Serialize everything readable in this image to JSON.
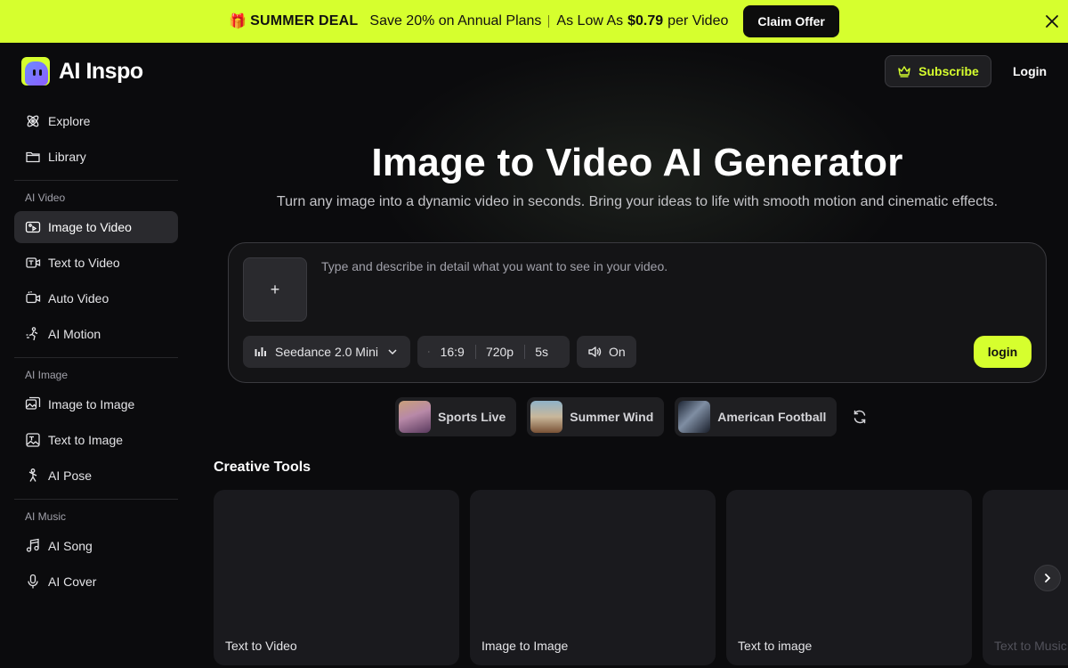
{
  "promo": {
    "gift_icon": "🎁",
    "deal_label": "SUMMER DEAL",
    "offer_text": "Save 20% on Annual Plans",
    "price_prefix": "As Low As",
    "price": "$0.79",
    "price_suffix": "per Video",
    "cta_label": "Claim Offer"
  },
  "brand": {
    "name": "AI Inspo",
    "accent_color": "#d6ff2e"
  },
  "header": {
    "subscribe_label": "Subscribe",
    "login_label": "Login"
  },
  "sidebar": {
    "top_items": [
      {
        "label": "Explore",
        "icon": "atom-icon"
      },
      {
        "label": "Library",
        "icon": "folder-icon"
      }
    ],
    "sections": [
      {
        "title": "AI Video",
        "items": [
          {
            "label": "Image to Video",
            "icon": "image-video-icon",
            "active": true
          },
          {
            "label": "Text to Video",
            "icon": "text-video-icon"
          },
          {
            "label": "Auto Video",
            "icon": "camera-icon"
          },
          {
            "label": "AI Motion",
            "icon": "motion-icon"
          }
        ]
      },
      {
        "title": "AI Image",
        "items": [
          {
            "label": "Image to Image",
            "icon": "image-image-icon"
          },
          {
            "label": "Text to Image",
            "icon": "text-image-icon"
          },
          {
            "label": "AI Pose",
            "icon": "pose-icon"
          }
        ]
      },
      {
        "title": "AI Music",
        "items": [
          {
            "label": "AI Song",
            "icon": "music-note-icon"
          },
          {
            "label": "AI Cover",
            "icon": "microphone-icon"
          }
        ]
      }
    ]
  },
  "hero": {
    "title": "Image to Video AI Generator",
    "subtitle": "Turn any image into a dynamic video in seconds. Bring your ideas to life with smooth motion and cinematic effects."
  },
  "prompt": {
    "upload_glyph": "+",
    "placeholder": "Type and describe in detail what you want to see in your video.",
    "model": "Seedance 2.0 Mini",
    "aspect_ratio": "16:9",
    "resolution": "720p",
    "duration": "5s",
    "sound": "On",
    "generate_label": "login"
  },
  "examples": [
    {
      "label": "Sports Live"
    },
    {
      "label": "Summer Wind"
    },
    {
      "label": "American Football"
    }
  ],
  "creative_tools": {
    "title": "Creative Tools",
    "cards": [
      "Text to Video",
      "Image to Image",
      "Text to image",
      "Text to Music"
    ]
  }
}
